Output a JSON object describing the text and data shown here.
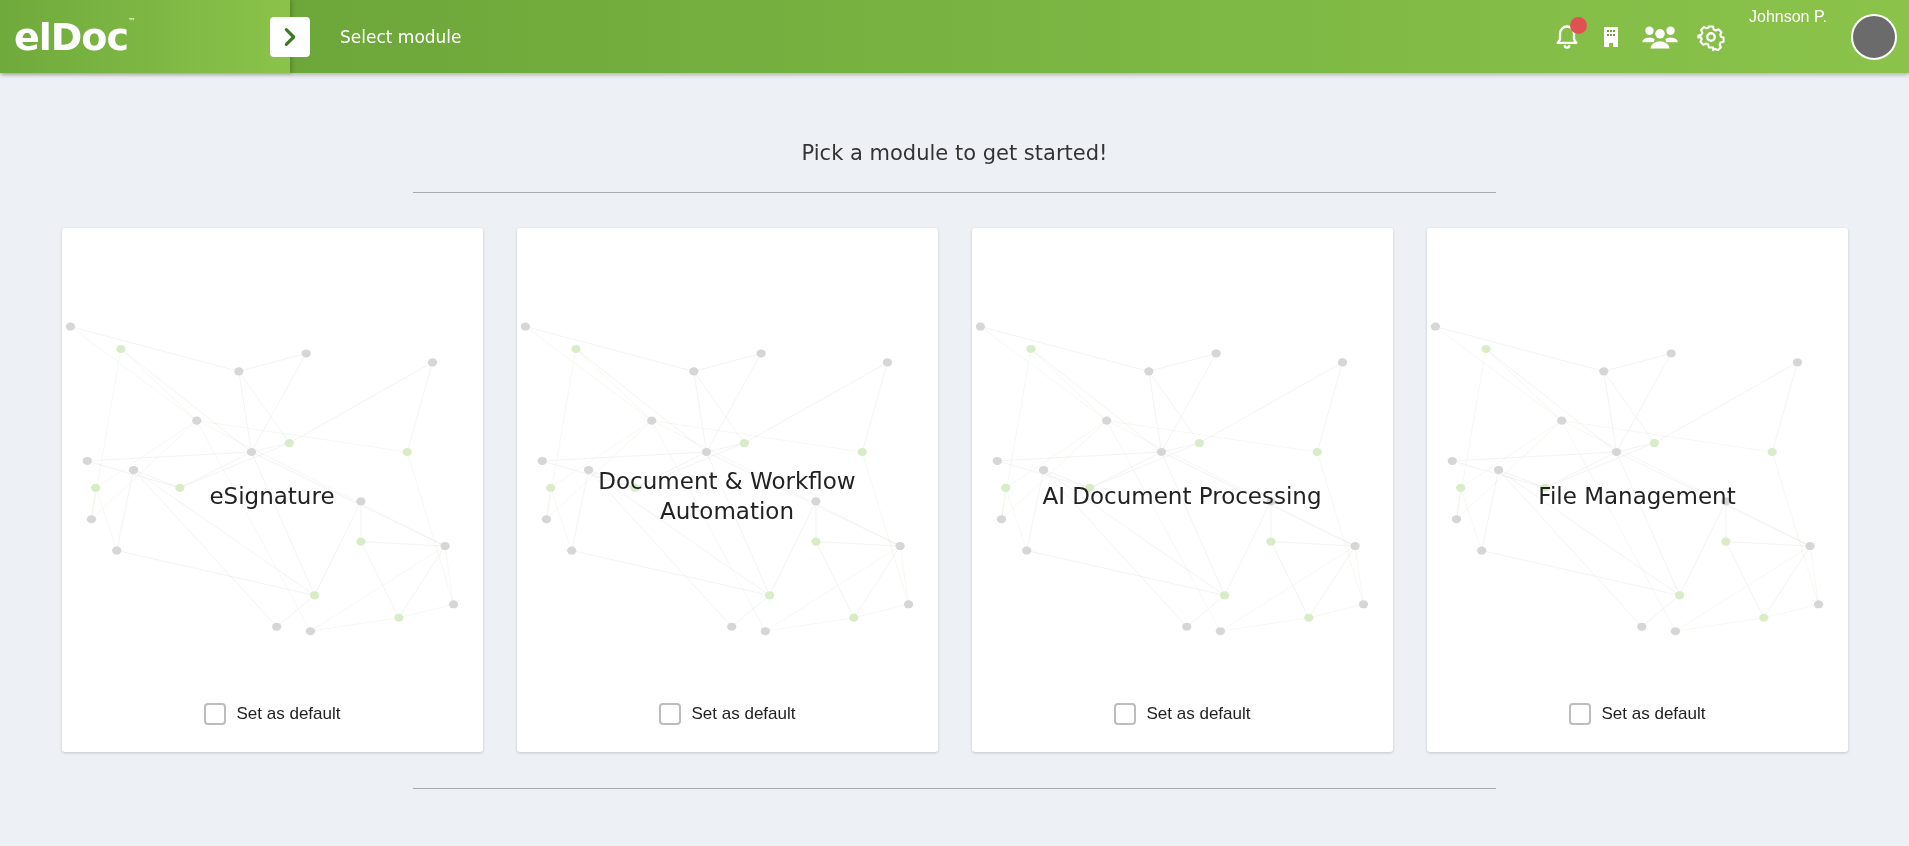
{
  "header": {
    "logo": "elDoc",
    "logo_mark": "™",
    "page_title": "Select module",
    "notifications": {
      "unread": true
    },
    "user_name": "Johnson P."
  },
  "heading": "Pick a module to get started!",
  "modules": [
    {
      "title": "eSignature",
      "default_label": "Set as default",
      "checked": false
    },
    {
      "title": "Document & Workflow Automation",
      "default_label": "Set as default",
      "checked": false
    },
    {
      "title": "AI Document Processing",
      "default_label": "Set as default",
      "checked": false
    },
    {
      "title": "File Management",
      "default_label": "Set as default",
      "checked": false
    }
  ]
}
